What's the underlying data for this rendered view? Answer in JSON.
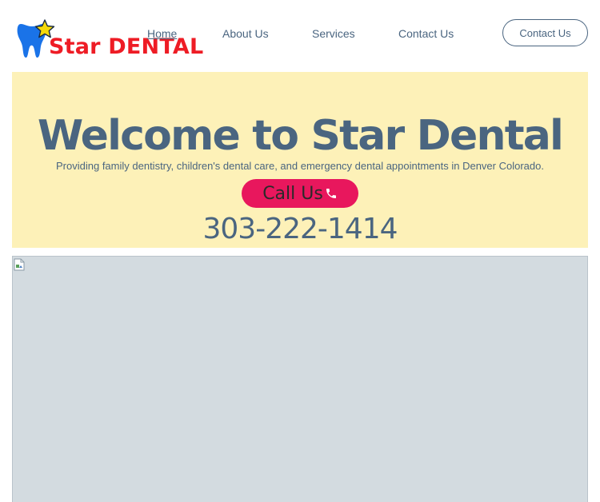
{
  "brand": {
    "name": "Star DENTAL",
    "colors": {
      "tooth": "#1a73e8",
      "star": "#f5d90a",
      "text": "#ee1c25"
    }
  },
  "nav": {
    "items": [
      {
        "label": "Home",
        "active": true
      },
      {
        "label": "About Us",
        "active": false
      },
      {
        "label": "Services",
        "active": false
      },
      {
        "label": "Contact Us",
        "active": false
      }
    ]
  },
  "header": {
    "cta_label": "Contact Us"
  },
  "hero": {
    "title": "Welcome to Star Dental",
    "subtitle": "Providing family dentistry, children's dental care, and emergency dental appointments in Denver Colorado.",
    "call_label": "Call Us",
    "call_icon": "phone-icon",
    "phone": "303-222-1414",
    "background": "#fdf1b8",
    "accent": "#e8175d"
  },
  "image": {
    "icon": "broken-image-icon"
  }
}
